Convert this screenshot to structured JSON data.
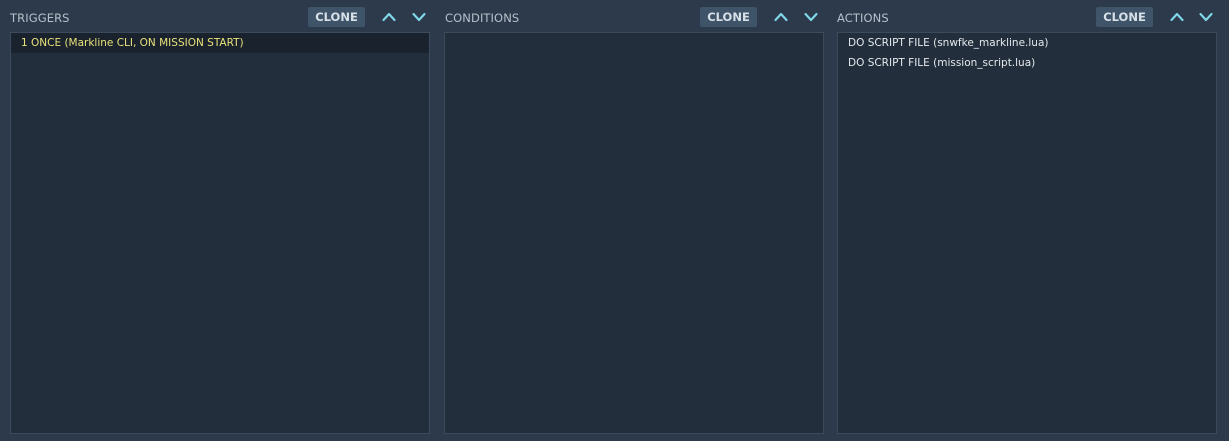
{
  "triggers": {
    "title": "TRIGGERS",
    "clone_label": "CLONE",
    "items": [
      {
        "label": "1 ONCE (Markline CLI, ON MISSION START)",
        "selected": true
      }
    ]
  },
  "conditions": {
    "title": "CONDITIONS",
    "clone_label": "CLONE",
    "items": []
  },
  "actions": {
    "title": "ACTIONS",
    "clone_label": "CLONE",
    "items": [
      {
        "label": "DO SCRIPT FILE (snwfke_markline.lua)"
      },
      {
        "label": "DO SCRIPT FILE (mission_script.lua)"
      }
    ]
  },
  "icons": {
    "move_up": "chevron-up-icon",
    "move_down": "chevron-down-icon"
  },
  "colors": {
    "background": "#2c3a4b",
    "list_background": "#222e3b",
    "button_background": "#3f5469",
    "arrow": "#7fd6e6",
    "selected_text": "#e8e07a",
    "text": "#e4e9ee"
  }
}
